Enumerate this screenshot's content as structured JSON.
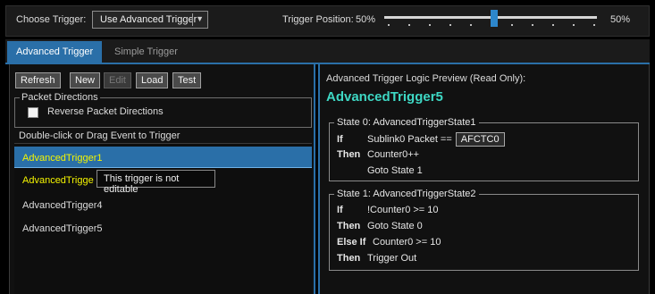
{
  "header": {
    "choose_trigger_label": "Choose Trigger:",
    "choose_trigger_value": "Use Advanced Trigger",
    "trigger_position_label": "Trigger Position:",
    "trigger_position_value": "50%",
    "trigger_position_value_right": "50%",
    "trigger_position_fraction": 0.5
  },
  "tabs": [
    {
      "label": "Advanced Trigger",
      "active": true
    },
    {
      "label": "Simple Trigger",
      "active": false
    }
  ],
  "toolbar": {
    "refresh_label": "Refresh",
    "new_label": "New",
    "edit_label": "Edit",
    "load_label": "Load",
    "test_label": "Test"
  },
  "packet_directions": {
    "title": "Packet Directions",
    "checkbox_label": "Reverse Packet Directions"
  },
  "list_hint": "Double-click or Drag Event to Trigger",
  "triggers": [
    {
      "label": "AdvancedTrigger1"
    },
    {
      "label": "AdvancedTrigge"
    },
    {
      "label": "AdvancedTrigger4"
    },
    {
      "label": "AdvancedTrigger5"
    }
  ],
  "tooltip": "This trigger is not editable",
  "preview": {
    "header": "Advanced Trigger Logic Preview (Read Only):",
    "name": "AdvancedTrigger5",
    "states": [
      {
        "title": "State 0: AdvancedTriggerState1",
        "lines": [
          {
            "kw": "If",
            "text": "Sublink0 Packet ==",
            "box": "AFCTC0"
          },
          {
            "kw": "Then",
            "text": "Counter0++"
          },
          {
            "kw": "",
            "text": "Goto State 1"
          }
        ]
      },
      {
        "title": "State 1: AdvancedTriggerState2",
        "lines": [
          {
            "kw": "If",
            "text": "!Counter0 >= 10"
          },
          {
            "kw": "Then",
            "text": "Goto State 0"
          },
          {
            "kw": "Else If",
            "text": "Counter0 >= 10"
          },
          {
            "kw": "Then",
            "text": "Trigger Out"
          }
        ]
      }
    ]
  },
  "colors": {
    "accent": "#2a6fa8",
    "highlight_text": "#f4f400",
    "title_teal": "#3ed8c4"
  }
}
